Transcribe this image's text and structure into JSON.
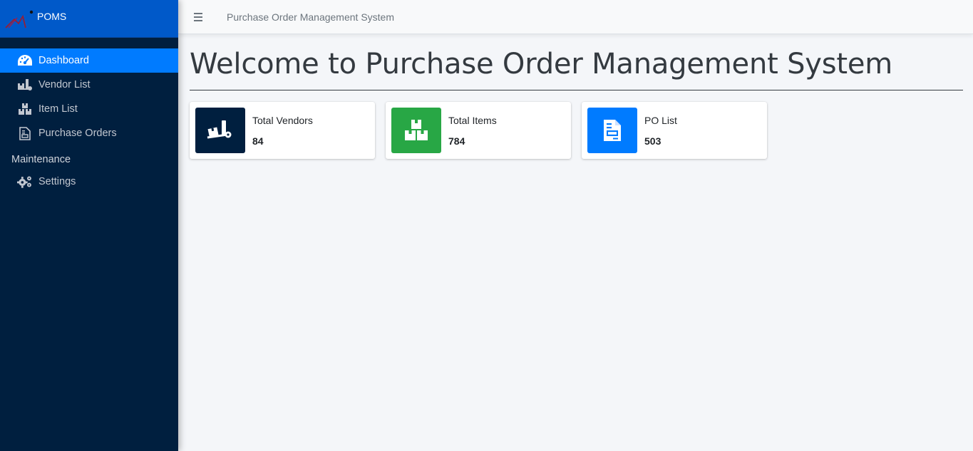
{
  "brand": {
    "name": "POMS"
  },
  "topbar": {
    "title": "Purchase Order Management System"
  },
  "sidebar": {
    "items": [
      {
        "label": "Dashboard",
        "icon": "tachometer-icon",
        "active": true
      },
      {
        "label": "Vendor List",
        "icon": "truck-loading-icon"
      },
      {
        "label": "Item List",
        "icon": "boxes-icon"
      },
      {
        "label": "Purchase Orders",
        "icon": "file-invoice-icon"
      }
    ],
    "section_header": "Maintenance",
    "maintenance_items": [
      {
        "label": "Settings",
        "icon": "cogs-icon"
      }
    ]
  },
  "main": {
    "title": "Welcome to Purchase Order Management System",
    "cards": [
      {
        "label": "Total Vendors",
        "value": "84",
        "color": "#001f3f",
        "icon": "truck-loading-icon"
      },
      {
        "label": "Total Items",
        "value": "784",
        "color": "#28a745",
        "icon": "boxes-icon"
      },
      {
        "label": "PO List",
        "value": "503",
        "color": "#007bff",
        "icon": "file-invoice-icon"
      }
    ]
  },
  "colors": {
    "sidebar": "#001f3f",
    "brand": "#0059c9",
    "active": "#007bff",
    "background": "#f4f6f9"
  }
}
